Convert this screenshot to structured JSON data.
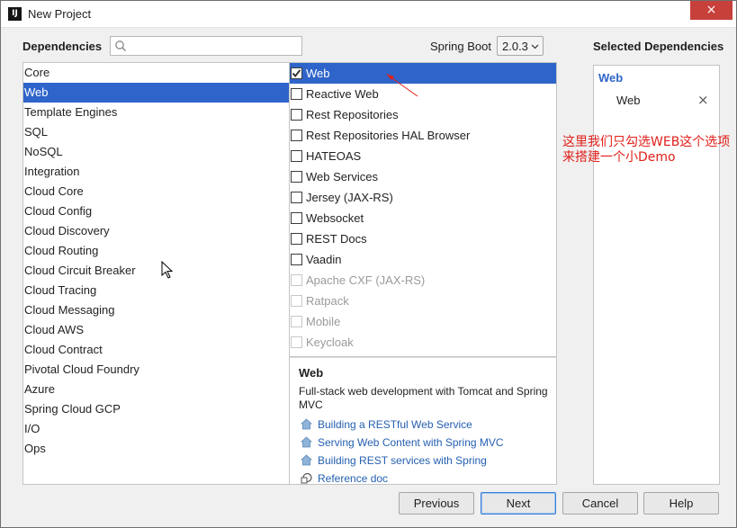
{
  "window": {
    "title": "New Project",
    "close_icon": "×",
    "app_icon_label": "IJ"
  },
  "header": {
    "dependencies_label": "Dependencies",
    "search_placeholder": "",
    "spring_boot_label": "Spring Boot",
    "spring_boot_version": "2.0.3",
    "selected_dependencies_label": "Selected Dependencies"
  },
  "categories": [
    "Core",
    "Web",
    "Template Engines",
    "SQL",
    "NoSQL",
    "Integration",
    "Cloud Core",
    "Cloud Config",
    "Cloud Discovery",
    "Cloud Routing",
    "Cloud Circuit Breaker",
    "Cloud Tracing",
    "Cloud Messaging",
    "Cloud AWS",
    "Cloud Contract",
    "Pivotal Cloud Foundry",
    "Azure",
    "Spring Cloud GCP",
    "I/O",
    "Ops"
  ],
  "selected_category_index": 1,
  "dependencies": [
    {
      "label": "Web",
      "checked": true,
      "enabled": true
    },
    {
      "label": "Reactive Web",
      "checked": false,
      "enabled": true
    },
    {
      "label": "Rest Repositories",
      "checked": false,
      "enabled": true
    },
    {
      "label": "Rest Repositories HAL Browser",
      "checked": false,
      "enabled": true
    },
    {
      "label": "HATEOAS",
      "checked": false,
      "enabled": true
    },
    {
      "label": "Web Services",
      "checked": false,
      "enabled": true
    },
    {
      "label": "Jersey (JAX-RS)",
      "checked": false,
      "enabled": true
    },
    {
      "label": "Websocket",
      "checked": false,
      "enabled": true
    },
    {
      "label": "REST Docs",
      "checked": false,
      "enabled": true
    },
    {
      "label": "Vaadin",
      "checked": false,
      "enabled": true
    },
    {
      "label": "Apache CXF (JAX-RS)",
      "checked": false,
      "enabled": false
    },
    {
      "label": "Ratpack",
      "checked": false,
      "enabled": false
    },
    {
      "label": "Mobile",
      "checked": false,
      "enabled": false
    },
    {
      "label": "Keycloak",
      "checked": false,
      "enabled": false
    }
  ],
  "selected_dependency_index": 0,
  "description": {
    "title": "Web",
    "text": "Full-stack web development with Tomcat and Spring MVC",
    "guides": [
      {
        "label": "Building a RESTful Web Service",
        "icon": "home-icon"
      },
      {
        "label": "Serving Web Content with Spring MVC",
        "icon": "home-icon"
      },
      {
        "label": "Building REST services with Spring",
        "icon": "home-icon"
      },
      {
        "label": "Reference doc",
        "icon": "reference-icon"
      }
    ]
  },
  "selected_panel": {
    "group": "Web",
    "items": [
      {
        "label": "Web",
        "remove_icon": "×"
      }
    ]
  },
  "annotation": {
    "text": "这里我们只勾选WEB这个选项来搭建一个小Demo",
    "color": "#e0201a"
  },
  "buttons": {
    "previous": "Previous",
    "next": "Next",
    "cancel": "Cancel",
    "help": "Help"
  },
  "colors": {
    "selection": "#2f65ca",
    "link": "#2560b0",
    "annotation": "#e0201a"
  }
}
